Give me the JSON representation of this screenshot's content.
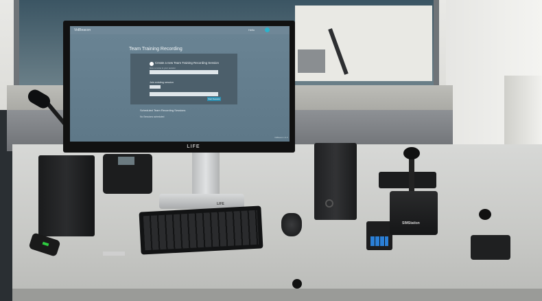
{
  "screen": {
    "brand": "VidBeacon",
    "user": "Hello",
    "heading": "Team Training Recording",
    "create_label": "Create a new Team Training Recording Session",
    "create_note": "Give a name to your session",
    "join_label": "Join existing session",
    "button_label": "Start Session",
    "scheduled_heading": "Scheduled Team Recording Sessions",
    "none_scheduled": "No Sessions scheduled",
    "footer": "VidBeacon v1.0"
  },
  "hardware_labels": {
    "monitor_logo": "LIFE",
    "stand_logo": "LIFE",
    "gooseneck_label": "SIMStation"
  },
  "colors": {
    "screen_bg": "#627d8d",
    "panel": "#4c5f6b",
    "accent": "#2e8fb0",
    "avatar": "#2bb3cc",
    "dongle_light": "#2ecc40",
    "battery": "#2b7fd6"
  }
}
